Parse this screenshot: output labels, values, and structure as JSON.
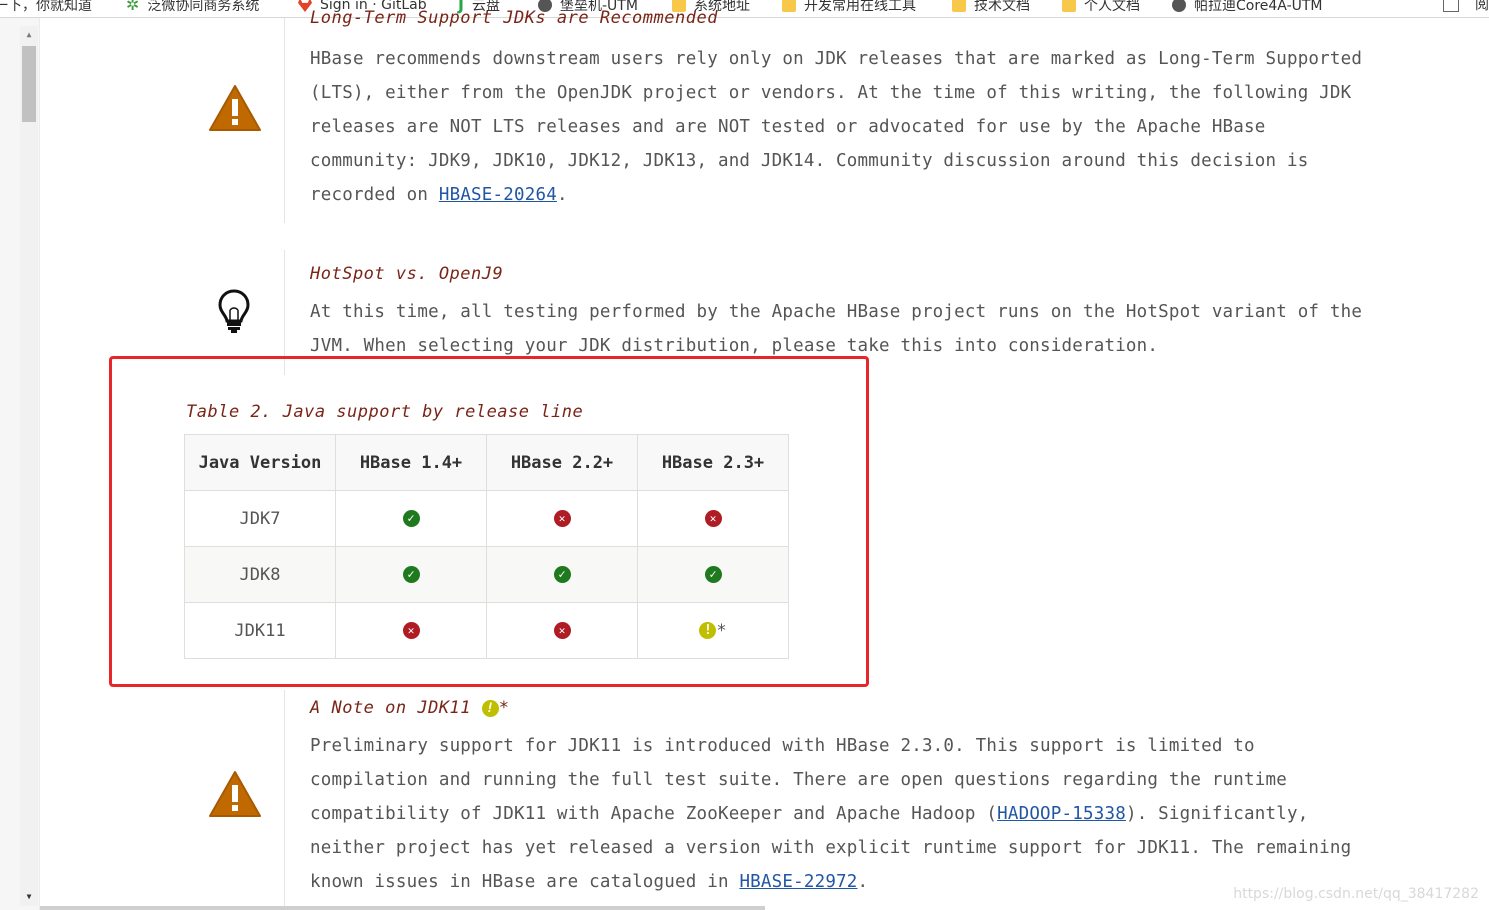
{
  "bookmarks": {
    "items": [
      {
        "label": "一下，你就知道",
        "icon": "none"
      },
      {
        "label": "泛微协同商务系统",
        "icon": "star-icon"
      },
      {
        "label": "Sign in · GitLab",
        "icon": "gitlab-icon"
      },
      {
        "label": "云盘",
        "icon": "j-icon"
      },
      {
        "label": "堡垒机-UTM",
        "icon": "globe-icon"
      },
      {
        "label": "系统地址",
        "icon": "folder-icon"
      },
      {
        "label": "开发常用在线工具",
        "icon": "folder-icon"
      },
      {
        "label": "技术文档",
        "icon": "folder-icon"
      },
      {
        "label": "个人文档",
        "icon": "folder-icon"
      },
      {
        "label": "帕拉迪Core4A-UTM",
        "icon": "globe-icon"
      }
    ],
    "overflow_label": "阅"
  },
  "lts_note": {
    "title": "Long-Term Support JDKs are Recommended",
    "text_before_link": "HBase recommends downstream users rely only on JDK releases that are marked as Long-Term Supported (LTS), either from the OpenJDK project or vendors. At the time of this writing, the following JDK releases are NOT LTS releases and are NOT tested or advocated for use by the Apache HBase community: JDK9, JDK10, JDK12, JDK13, and JDK14. Community discussion around this decision is recorded on ",
    "link_text": "HBASE-20264",
    "text_after_link": "."
  },
  "hotspot_tip": {
    "title": "HotSpot vs. OpenJ9",
    "text": "At this time, all testing performed by the Apache HBase project runs on the HotSpot variant of the JVM. When selecting your JDK distribution, please take this into consideration."
  },
  "table": {
    "caption": "Table 2. Java support by release line",
    "headers": [
      "Java Version",
      "HBase 1.4+",
      "HBase 2.2+",
      "HBase 2.3+"
    ],
    "rows": [
      {
        "version": "JDK7",
        "cells": [
          "supported",
          "not-supported",
          "not-supported"
        ]
      },
      {
        "version": "JDK8",
        "cells": [
          "supported",
          "supported",
          "supported"
        ]
      },
      {
        "version": "JDK11",
        "cells": [
          "not-supported",
          "not-supported",
          "partial"
        ]
      }
    ],
    "partial_suffix": "*",
    "highlight_color": "#e8262a"
  },
  "jdk11_note": {
    "title": "A Note on JDK11",
    "title_suffix": "*",
    "text_1": "Preliminary support for JDK11 is introduced with HBase 2.3.0. This support is limited to compilation and running the full test suite. There are open questions regarding the runtime compatibility of JDK11 with Apache ZooKeeper and Apache Hadoop (",
    "link_1": "HADOOP-15338",
    "text_2": "). Significantly, neither project has yet released a version with explicit runtime support for JDK11. The remaining known issues in HBase are catalogued in ",
    "link_2": "HBASE-22972",
    "text_3": "."
  },
  "watermark": "https://blog.csdn.net/qq_38417282",
  "colors": {
    "title": "#7a2518",
    "link": "#2156a5",
    "supported": "#1f7a1f",
    "not_supported": "#b01c24",
    "partial": "#bfbf00",
    "warning_icon": "#bf6900"
  }
}
